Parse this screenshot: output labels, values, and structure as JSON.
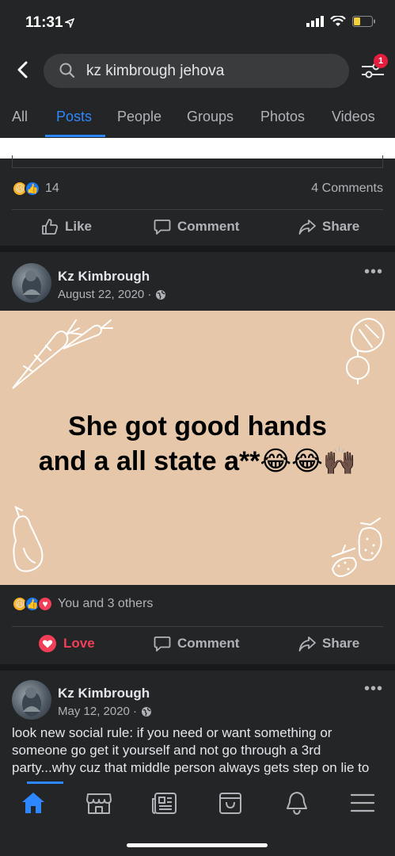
{
  "status": {
    "time": "11:31"
  },
  "search": {
    "query": "kz kimbrough jehova",
    "filter_badge": "1"
  },
  "tabs": [
    {
      "label": "All"
    },
    {
      "label": "Posts"
    },
    {
      "label": "People"
    },
    {
      "label": "Groups"
    },
    {
      "label": "Photos"
    },
    {
      "label": "Videos"
    }
  ],
  "post1": {
    "reaction_count": "14",
    "comments": "4 Comments",
    "like": "Like",
    "comment": "Comment",
    "share": "Share"
  },
  "post2": {
    "author": "Kz Kimbrough",
    "date": "August 22, 2020 ·",
    "card_line1": "She got good hands",
    "card_line2": "and a all state a**😂😂🙌🏿",
    "reactions_text": "You and 3 others",
    "love": "Love",
    "comment": "Comment",
    "share": "Share"
  },
  "post3": {
    "author": "Kz Kimbrough",
    "date": "May 12, 2020 ·",
    "body": "look new social rule: if you need or want something or someone go get it yourself and not go through a 3rd party...why cuz that middle person always gets step on lie to"
  },
  "colors": {
    "accent": "#2d88ff",
    "love": "#f33e58",
    "card_bg": "#e6c7aa"
  }
}
